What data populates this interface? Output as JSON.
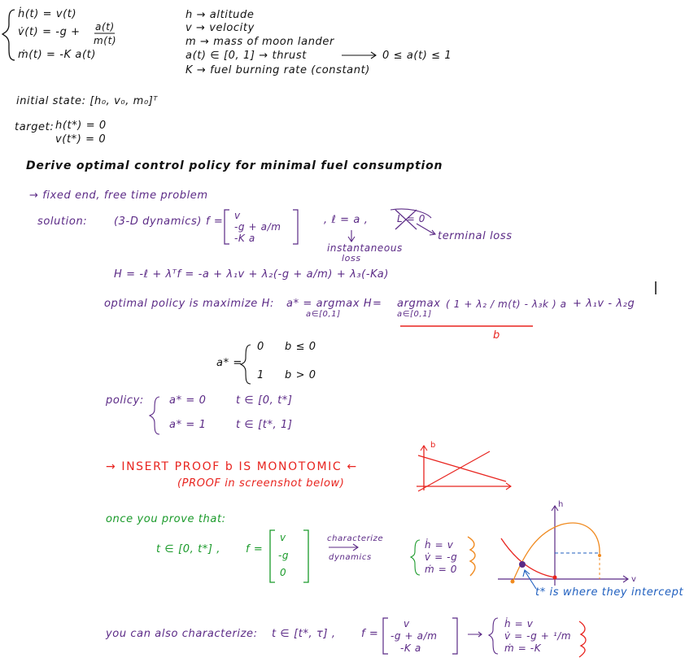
{
  "colors": {
    "black": "#111111",
    "purple": "#5b2a86",
    "red": "#e8241f",
    "green": "#1a9a2a",
    "orange": "#f08a1f",
    "blue": "#1f5fbf"
  },
  "dynamics": {
    "eq1": "ḣ(t) = v(t)",
    "eq2_left": "v̇(t) = -g +",
    "eq2_num": "a(t)",
    "eq2_den": "m(t)",
    "eq3": "ṁ(t) = -K a(t)"
  },
  "defs": {
    "h": "h → altitude",
    "v": "v → velocity",
    "m": "m → mass of moon lander",
    "a": "a(t) ∈ [0, 1] → thrust",
    "a_bound": "0 ≤ a(t) ≤ 1",
    "k": "K → fuel burning rate (constant)"
  },
  "initial_state": "initial state: [h₀, v₀, m₀]ᵀ",
  "target": {
    "label": "target:",
    "h": "h(t*) = 0",
    "v": "v(t*) = 0"
  },
  "heading": "Derive optimal control policy for minimal fuel consumption",
  "problem_type": "→ fixed end, free time problem",
  "solution": {
    "label": "solution:",
    "dyn_label": "(3-D dynamics)",
    "f_label": "f =",
    "f_row1": "v",
    "f_row2": "-g +  a/m",
    "f_row3": "-K a",
    "l_def": ", ℓ = a ,",
    "crossed": "L = 0",
    "terminal_loss": "terminal loss",
    "instantaneous_1": "instantaneous",
    "instantaneous_2": "loss"
  },
  "hamiltonian": "H = -ℓ + λᵀf = -a + λ₁v + λ₂(-g + a/m) + λ₃(-Ka)",
  "policy_max": {
    "label": "optimal policy is maximize H:",
    "astar": "a* = argmax H",
    "argmax_sub": "a∈[0,1]",
    "eq": "=",
    "argmax2": "argmax",
    "argmax2_sub": "a∈[0,1]",
    "expr_num": "( 1 + λ₂ / m(t) - λ₃k ) a",
    "expr_tail": "+ λ₁v - λ₂g",
    "b_label": "b"
  },
  "astar_cases": {
    "lhs": "a* =",
    "c1_val": "0",
    "c1_cond": "b ≤ 0",
    "c2_val": "1",
    "c2_cond": "b > 0"
  },
  "policy": {
    "label": "policy:",
    "c1": "a* = 0",
    "c1_t": "t ∈ [0, t*]",
    "c2": "a* = 1",
    "c2_t": "t ∈ [t*, 1]"
  },
  "proof": {
    "line": "→ INSERT PROOF b IS MONOTOMIC ←",
    "sub": "(PROOF in screenshot below)",
    "axis_label": "b"
  },
  "characterize": {
    "once": "once you prove that:",
    "t_range": "t ∈ [0, t*] ,",
    "f_label": "f =",
    "f_rows": [
      "v",
      "-g",
      "0"
    ],
    "arrow_label_1": "characterize",
    "arrow_label_2": "dynamics",
    "sys": [
      "ḣ = v",
      "v̇ = -g",
      "ṁ = 0"
    ],
    "plot_h": "h",
    "plot_v": "v",
    "intercept_note": "t* is where they intercept"
  },
  "also": {
    "text": "you can also characterize:",
    "t_range": "t ∈ [t*, τ] ,",
    "f_label": "f =",
    "f_rows": [
      "v",
      "-g + a/m",
      "-K a"
    ],
    "sys": [
      "ḣ = v",
      "v̇ = -g + ¹/m",
      "ṁ = -K"
    ]
  }
}
